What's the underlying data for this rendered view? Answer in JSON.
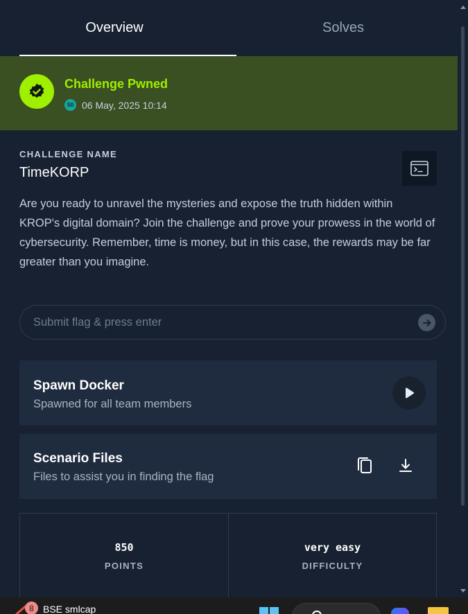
{
  "tabs": [
    {
      "label": "Overview",
      "active": true
    },
    {
      "label": "Solves",
      "active": false
    }
  ],
  "status": {
    "title": "Challenge Pwned",
    "avatar_initials": "S0",
    "timestamp": "06 May, 2025 10:14",
    "icon": "verified-badge-icon",
    "colors": {
      "accent": "#9fef00",
      "banner": "#3a4f22"
    }
  },
  "challenge": {
    "label": "CHALLENGE NAME",
    "name": "TimeKORP",
    "description": "Are you ready to unravel the mysteries and expose the truth hidden within KROP's digital domain? Join the challenge and prove your prowess in the world of cybersecurity. Remember, time is money, but in this case, the rewards may be far greater than you imagine.",
    "terminal_icon": "terminal-icon"
  },
  "flag": {
    "placeholder": "Submit flag & press enter",
    "value": "",
    "submit_icon": "arrow-right-icon"
  },
  "docker": {
    "title": "Spawn Docker",
    "subtitle": "Spawned for all team members",
    "action_icon": "play-icon"
  },
  "files": {
    "title": "Scenario Files",
    "subtitle": "Files to assist you in finding the flag",
    "copy_icon": "copy-icon",
    "download_icon": "download-icon"
  },
  "stats": [
    {
      "value": "850",
      "label": "POINTS"
    },
    {
      "value": "very easy",
      "label": "DIFFICULTY"
    }
  ],
  "taskbar": {
    "app_badge_count": "8",
    "app_label": "BSE smlcap"
  },
  "colors": {
    "background": "#172131",
    "card": "#1f2c3f",
    "border": "#2f3b4d"
  }
}
